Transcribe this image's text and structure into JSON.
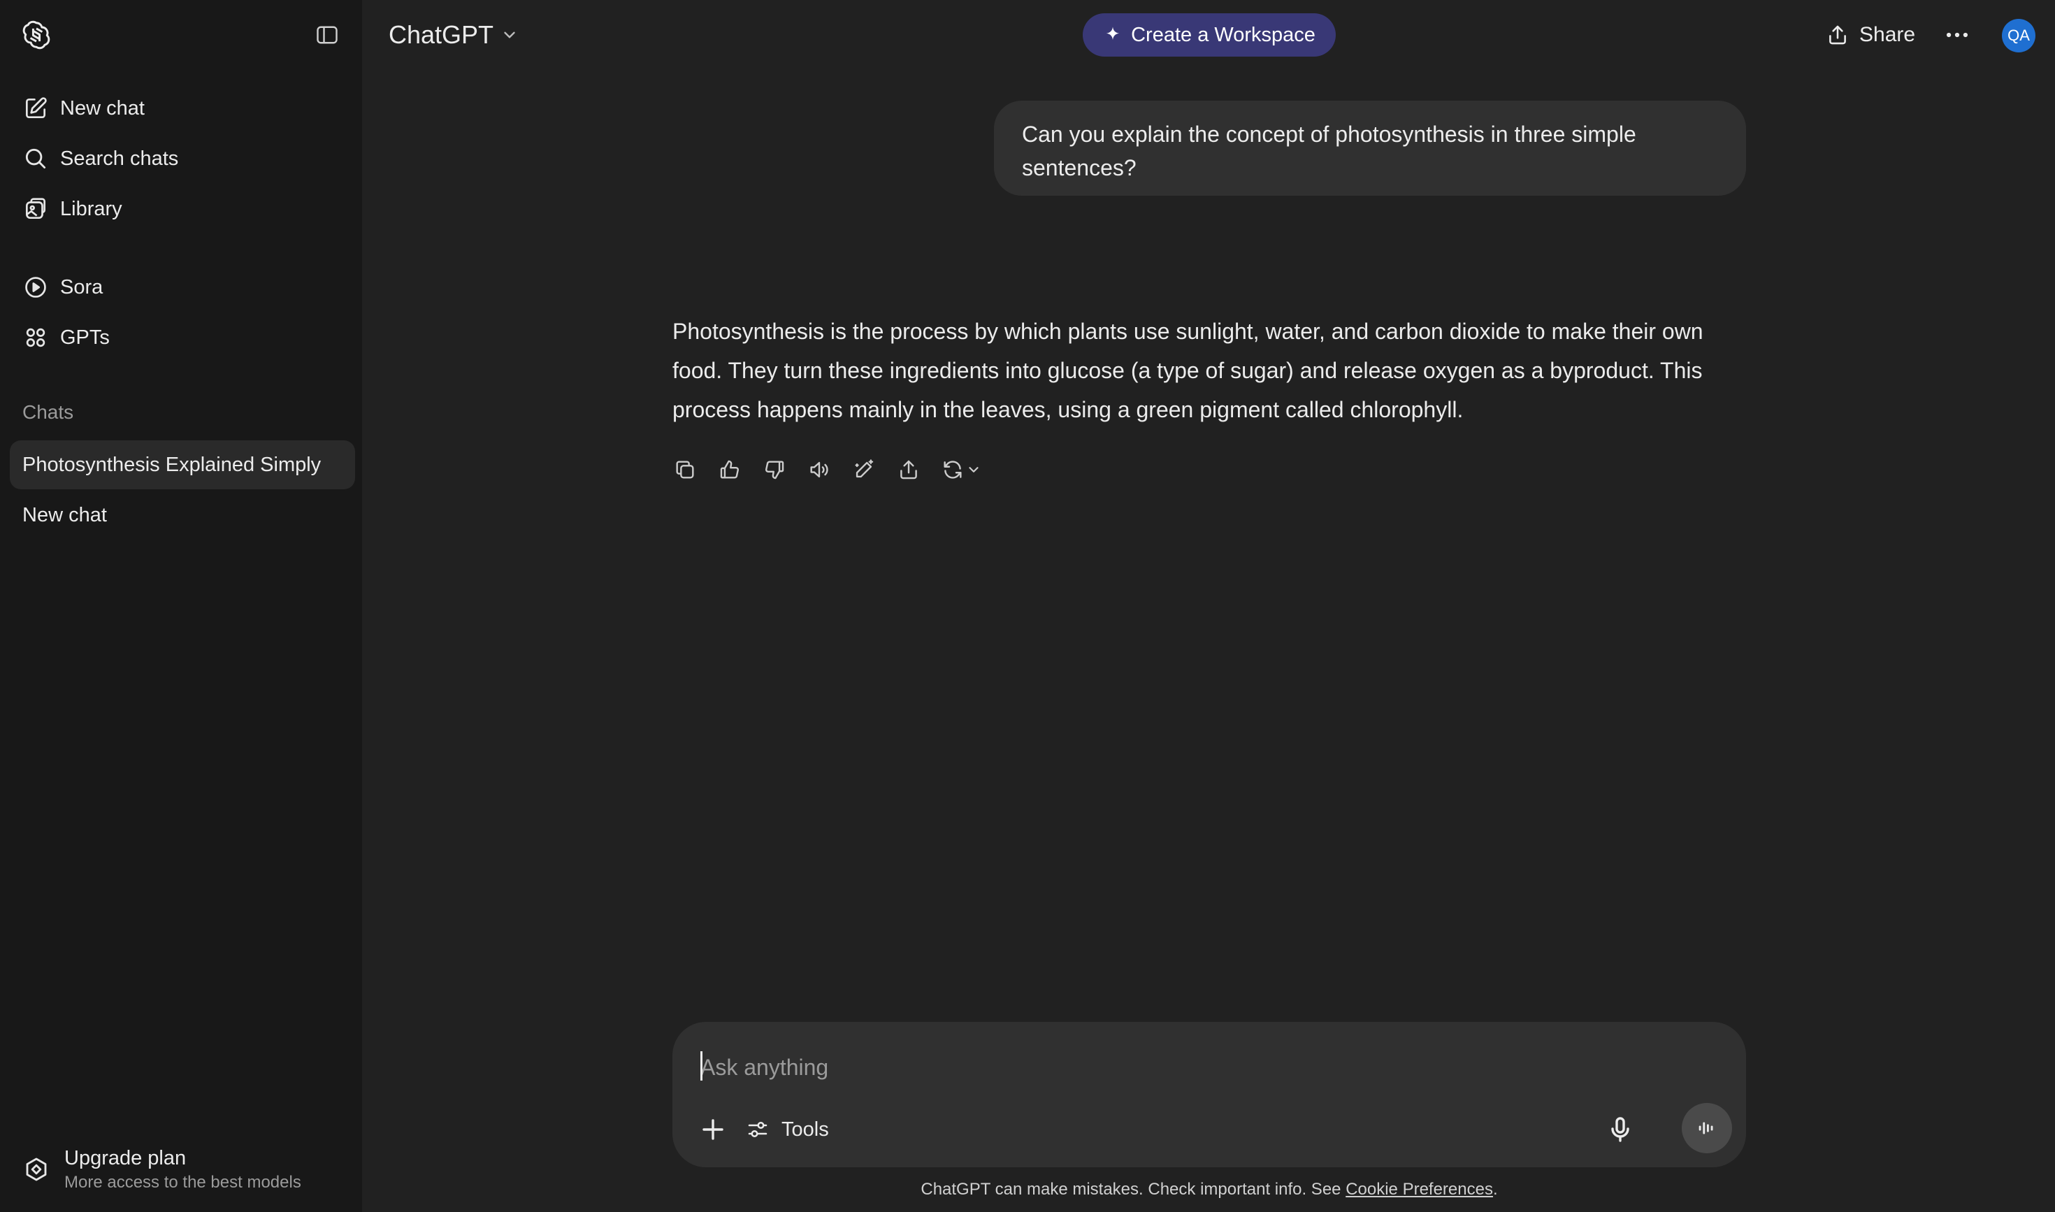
{
  "sidebar": {
    "items": [
      {
        "label": "New chat",
        "icon": "compose-icon"
      },
      {
        "label": "Search chats",
        "icon": "search-icon"
      },
      {
        "label": "Library",
        "icon": "library-icon"
      },
      {
        "label": "Sora",
        "icon": "play-icon"
      },
      {
        "label": "GPTs",
        "icon": "grid-icon"
      }
    ],
    "section_label": "Chats",
    "chats": [
      "Photosynthesis Explained Simply",
      "New chat"
    ],
    "upgrade": {
      "title": "Upgrade plan",
      "subtitle": "More access to the best models"
    }
  },
  "header": {
    "model": "ChatGPT",
    "workspace_label": "Create a Workspace",
    "share_label": "Share",
    "avatar_initials": "QA"
  },
  "conversation": {
    "user_message": "Can you explain the concept of photosynthesis in three simple sentences?",
    "assistant_message": "Photosynthesis is the process by which plants use sunlight, water, and carbon dioxide to make their own food. They turn these ingredients into glucose (a type of sugar) and release oxygen as a byproduct. This process happens mainly in the leaves, using a green pigment called chlorophyll."
  },
  "composer": {
    "placeholder": "Ask anything",
    "value": "",
    "tools_label": "Tools"
  },
  "footer": {
    "note": "ChatGPT can make mistakes. Check important info. See ",
    "link": "Cookie Preferences",
    "end": "."
  },
  "colors": {
    "background": "#212121",
    "sidebar": "#181818",
    "accent": "#393876",
    "avatar": "#1f6fd1"
  }
}
